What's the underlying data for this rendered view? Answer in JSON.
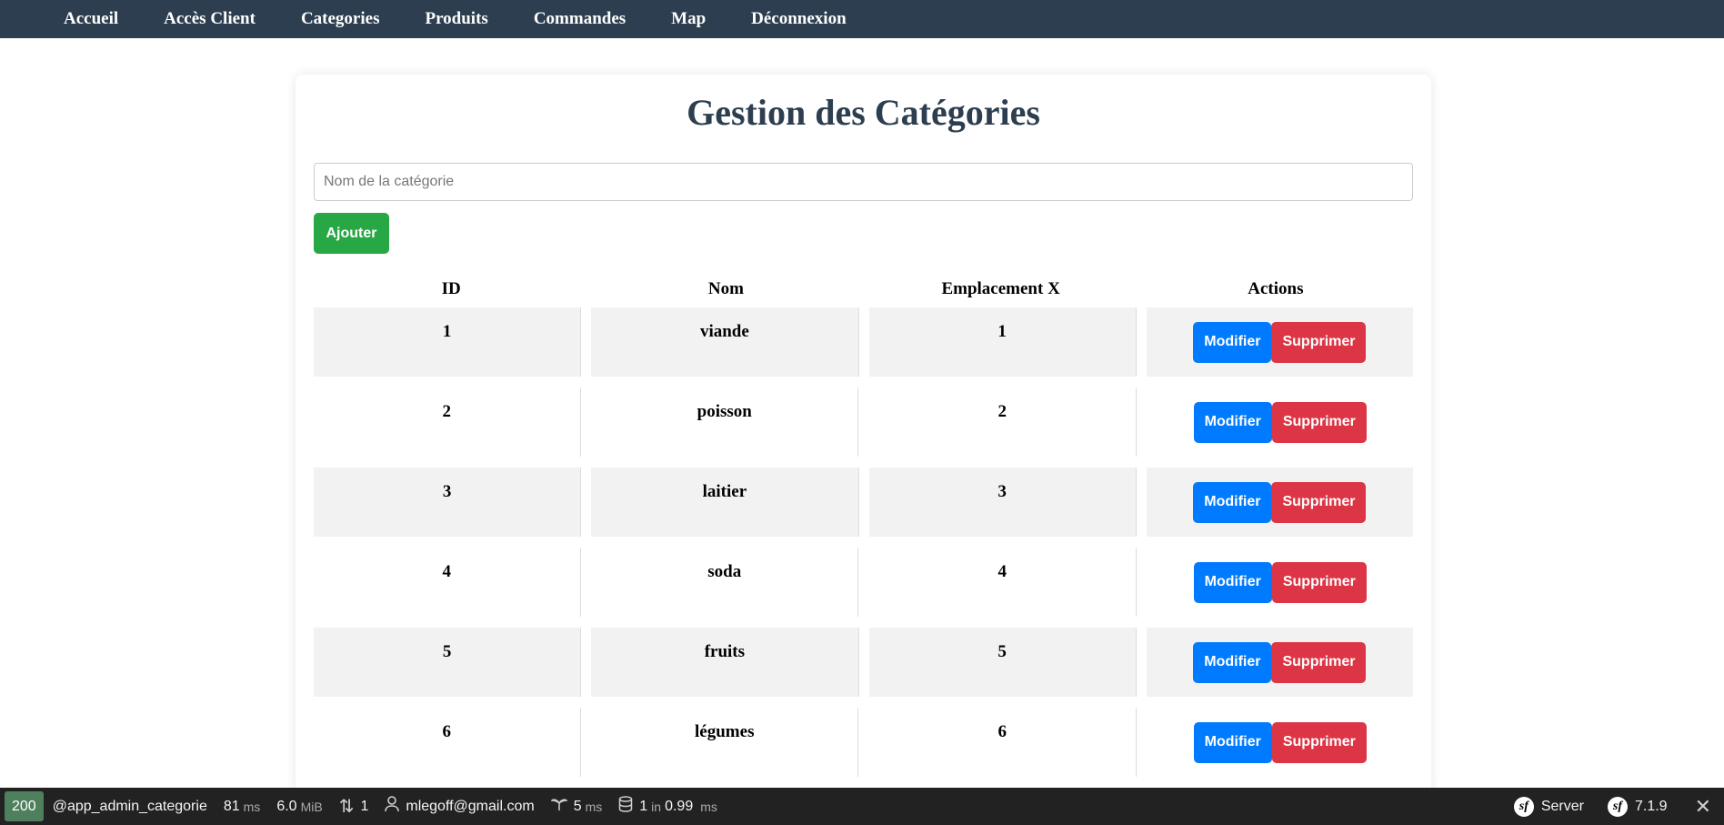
{
  "nav": {
    "items": [
      "Accueil",
      "Accès Client",
      "Categories",
      "Produits",
      "Commandes",
      "Map",
      "Déconnexion"
    ]
  },
  "page": {
    "title": "Gestion des Catégories",
    "input_placeholder": "Nom de la catégorie",
    "input_value": "",
    "add_label": "Ajouter"
  },
  "table": {
    "headers": [
      "ID",
      "Nom",
      "Emplacement X",
      "Actions"
    ],
    "rows": [
      {
        "id": "1",
        "nom": "viande",
        "emplacement": "1"
      },
      {
        "id": "2",
        "nom": "poisson",
        "emplacement": "2"
      },
      {
        "id": "3",
        "nom": "laitier",
        "emplacement": "3"
      },
      {
        "id": "4",
        "nom": "soda",
        "emplacement": "4"
      },
      {
        "id": "5",
        "nom": "fruits",
        "emplacement": "5"
      },
      {
        "id": "6",
        "nom": "légumes",
        "emplacement": "6"
      }
    ],
    "edit_label": "Modifier",
    "delete_label": "Supprimer"
  },
  "toolbar": {
    "status": "200",
    "route": "@app_admin_categorie",
    "time_value": "81",
    "time_unit": "ms",
    "memory_value": "6.0",
    "memory_unit": "MiB",
    "requests": "1",
    "user": "mlegoff@gmail.com",
    "twig_value": "5",
    "twig_unit": "ms",
    "db_queries": "1",
    "db_in": "in",
    "db_time": "0.99",
    "db_unit": "ms",
    "server_label": "Server",
    "version": "7.1.9"
  },
  "colors": {
    "nav_bg": "#2c3e50",
    "title": "#2c3e50",
    "add_button": "#28a745",
    "edit_button": "#007bff",
    "delete_button": "#dc3545",
    "status_badge": "#4f805d"
  }
}
